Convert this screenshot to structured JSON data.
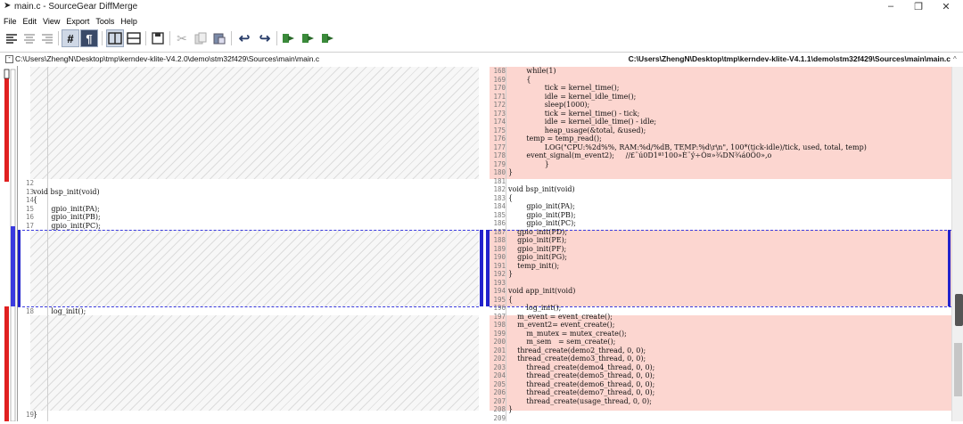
{
  "window": {
    "title": "main.c - SourceGear DiffMerge",
    "buttons": {
      "minimize": "–",
      "maximize": "❐",
      "close": "✕"
    }
  },
  "menu": [
    "File",
    "Edit",
    "View",
    "Export",
    "Tools",
    "Help"
  ],
  "toolbar": {
    "icons": [
      "align-left-icon",
      "align-center-icon",
      "align-right-icon",
      "line-number-icon",
      "pilcrow-icon",
      "two-pane-icon",
      "stacked-pane-icon",
      "save-icon",
      "cut-icon",
      "copy-icon",
      "paste-icon",
      "undo-icon",
      "redo-icon",
      "next-change-icon",
      "prev-change-icon",
      "apply-change-icon"
    ],
    "glyphs": {
      "hash": "#",
      "pilcrow": "¶"
    }
  },
  "left": {
    "path": "C:\\Users\\ZhengN\\Desktop\\tmp\\kerndev-klite-V4.2.0\\demo\\stm32f429\\Sources\\main\\main.c",
    "lines": [
      {
        "n": "12",
        "t": ""
      },
      {
        "n": "13",
        "t": "void bsp_init(void)"
      },
      {
        "n": "14",
        "t": "{"
      },
      {
        "n": "15",
        "t": "        gpio_init(PA);"
      },
      {
        "n": "16",
        "t": "        gpio_init(PB);"
      },
      {
        "n": "17",
        "t": "        gpio_init(PC);"
      },
      {
        "n": "18",
        "t": "        log_init();"
      },
      {
        "n": "19",
        "t": "}"
      }
    ]
  },
  "right": {
    "path": "C:\\Users\\ZhengN\\Desktop\\tmp\\kerndev-klite-V4.1.1\\demo\\stm32f429\\Sources\\main\\main.c",
    "lines": [
      {
        "n": "168",
        "t": "        while(1)"
      },
      {
        "n": "169",
        "t": "        {"
      },
      {
        "n": "170",
        "t": "                tick = kernel_time();"
      },
      {
        "n": "171",
        "t": "                idle = kernel_idle_time();"
      },
      {
        "n": "172",
        "t": "                sleep(1000);"
      },
      {
        "n": "173",
        "t": "                tick = kernel_time() - tick;"
      },
      {
        "n": "174",
        "t": "                idle = kernel_idle_time() - idle;"
      },
      {
        "n": "175",
        "t": "                heap_usage(&total, &used);"
      },
      {
        "n": "176",
        "t": "        temp = temp_read();"
      },
      {
        "n": "177",
        "t": "                LOG(\"CPU:%2d%%, RAM:%d/%dB, TEMP:%d\\r\\n\", 100*(tick-idle)/tick, used, total, temp)"
      },
      {
        "n": "178",
        "t": "        event_signal(m_event2);     //£¨ú0D1ª¹100»È¨ý÷Ò¤»¾DN¾á0Ö0»,o"
      },
      {
        "n": "179",
        "t": "                }"
      },
      {
        "n": "180",
        "t": "}"
      },
      {
        "n": "181",
        "t": ""
      },
      {
        "n": "182",
        "t": "void bsp_init(void)"
      },
      {
        "n": "183",
        "t": "{"
      },
      {
        "n": "184",
        "t": "        gpio_init(PA);"
      },
      {
        "n": "185",
        "t": "        gpio_init(PB);"
      },
      {
        "n": "186",
        "t": "        gpio_init(PC);"
      },
      {
        "n": "187",
        "t": "    gpio_init(PD);"
      },
      {
        "n": "188",
        "t": "    gpio_init(PE);"
      },
      {
        "n": "189",
        "t": "    gpio_init(PF);"
      },
      {
        "n": "190",
        "t": "    gpio_init(PG);"
      },
      {
        "n": "191",
        "t": "    temp_init();"
      },
      {
        "n": "192",
        "t": "}"
      },
      {
        "n": "193",
        "t": ""
      },
      {
        "n": "194",
        "t": "void app_init(void)"
      },
      {
        "n": "195",
        "t": "{"
      },
      {
        "n": "196",
        "t": "        log_init();"
      },
      {
        "n": "197",
        "t": "    m_event = event_create();"
      },
      {
        "n": "198",
        "t": "    m_event2= event_create();"
      },
      {
        "n": "199",
        "t": "        m_mutex = mutex_create();"
      },
      {
        "n": "200",
        "t": "        m_sem   = sem_create();"
      },
      {
        "n": "201",
        "t": "    thread_create(demo2_thread, 0, 0);"
      },
      {
        "n": "202",
        "t": "    thread_create(demo3_thread, 0, 0);"
      },
      {
        "n": "203",
        "t": "        thread_create(demo4_thread, 0, 0);"
      },
      {
        "n": "204",
        "t": "        thread_create(demo5_thread, 0, 0);"
      },
      {
        "n": "205",
        "t": "        thread_create(demo6_thread, 0, 0);"
      },
      {
        "n": "206",
        "t": "        thread_create(demo7_thread, 0, 0);"
      },
      {
        "n": "207",
        "t": "        thread_create(usage_thread, 0, 0);"
      },
      {
        "n": "208",
        "t": "}"
      },
      {
        "n": "209",
        "t": ""
      }
    ]
  },
  "colors": {
    "changed": "#fcd6d0",
    "accent": "#2222cc",
    "overview_changed": "#e02020"
  }
}
